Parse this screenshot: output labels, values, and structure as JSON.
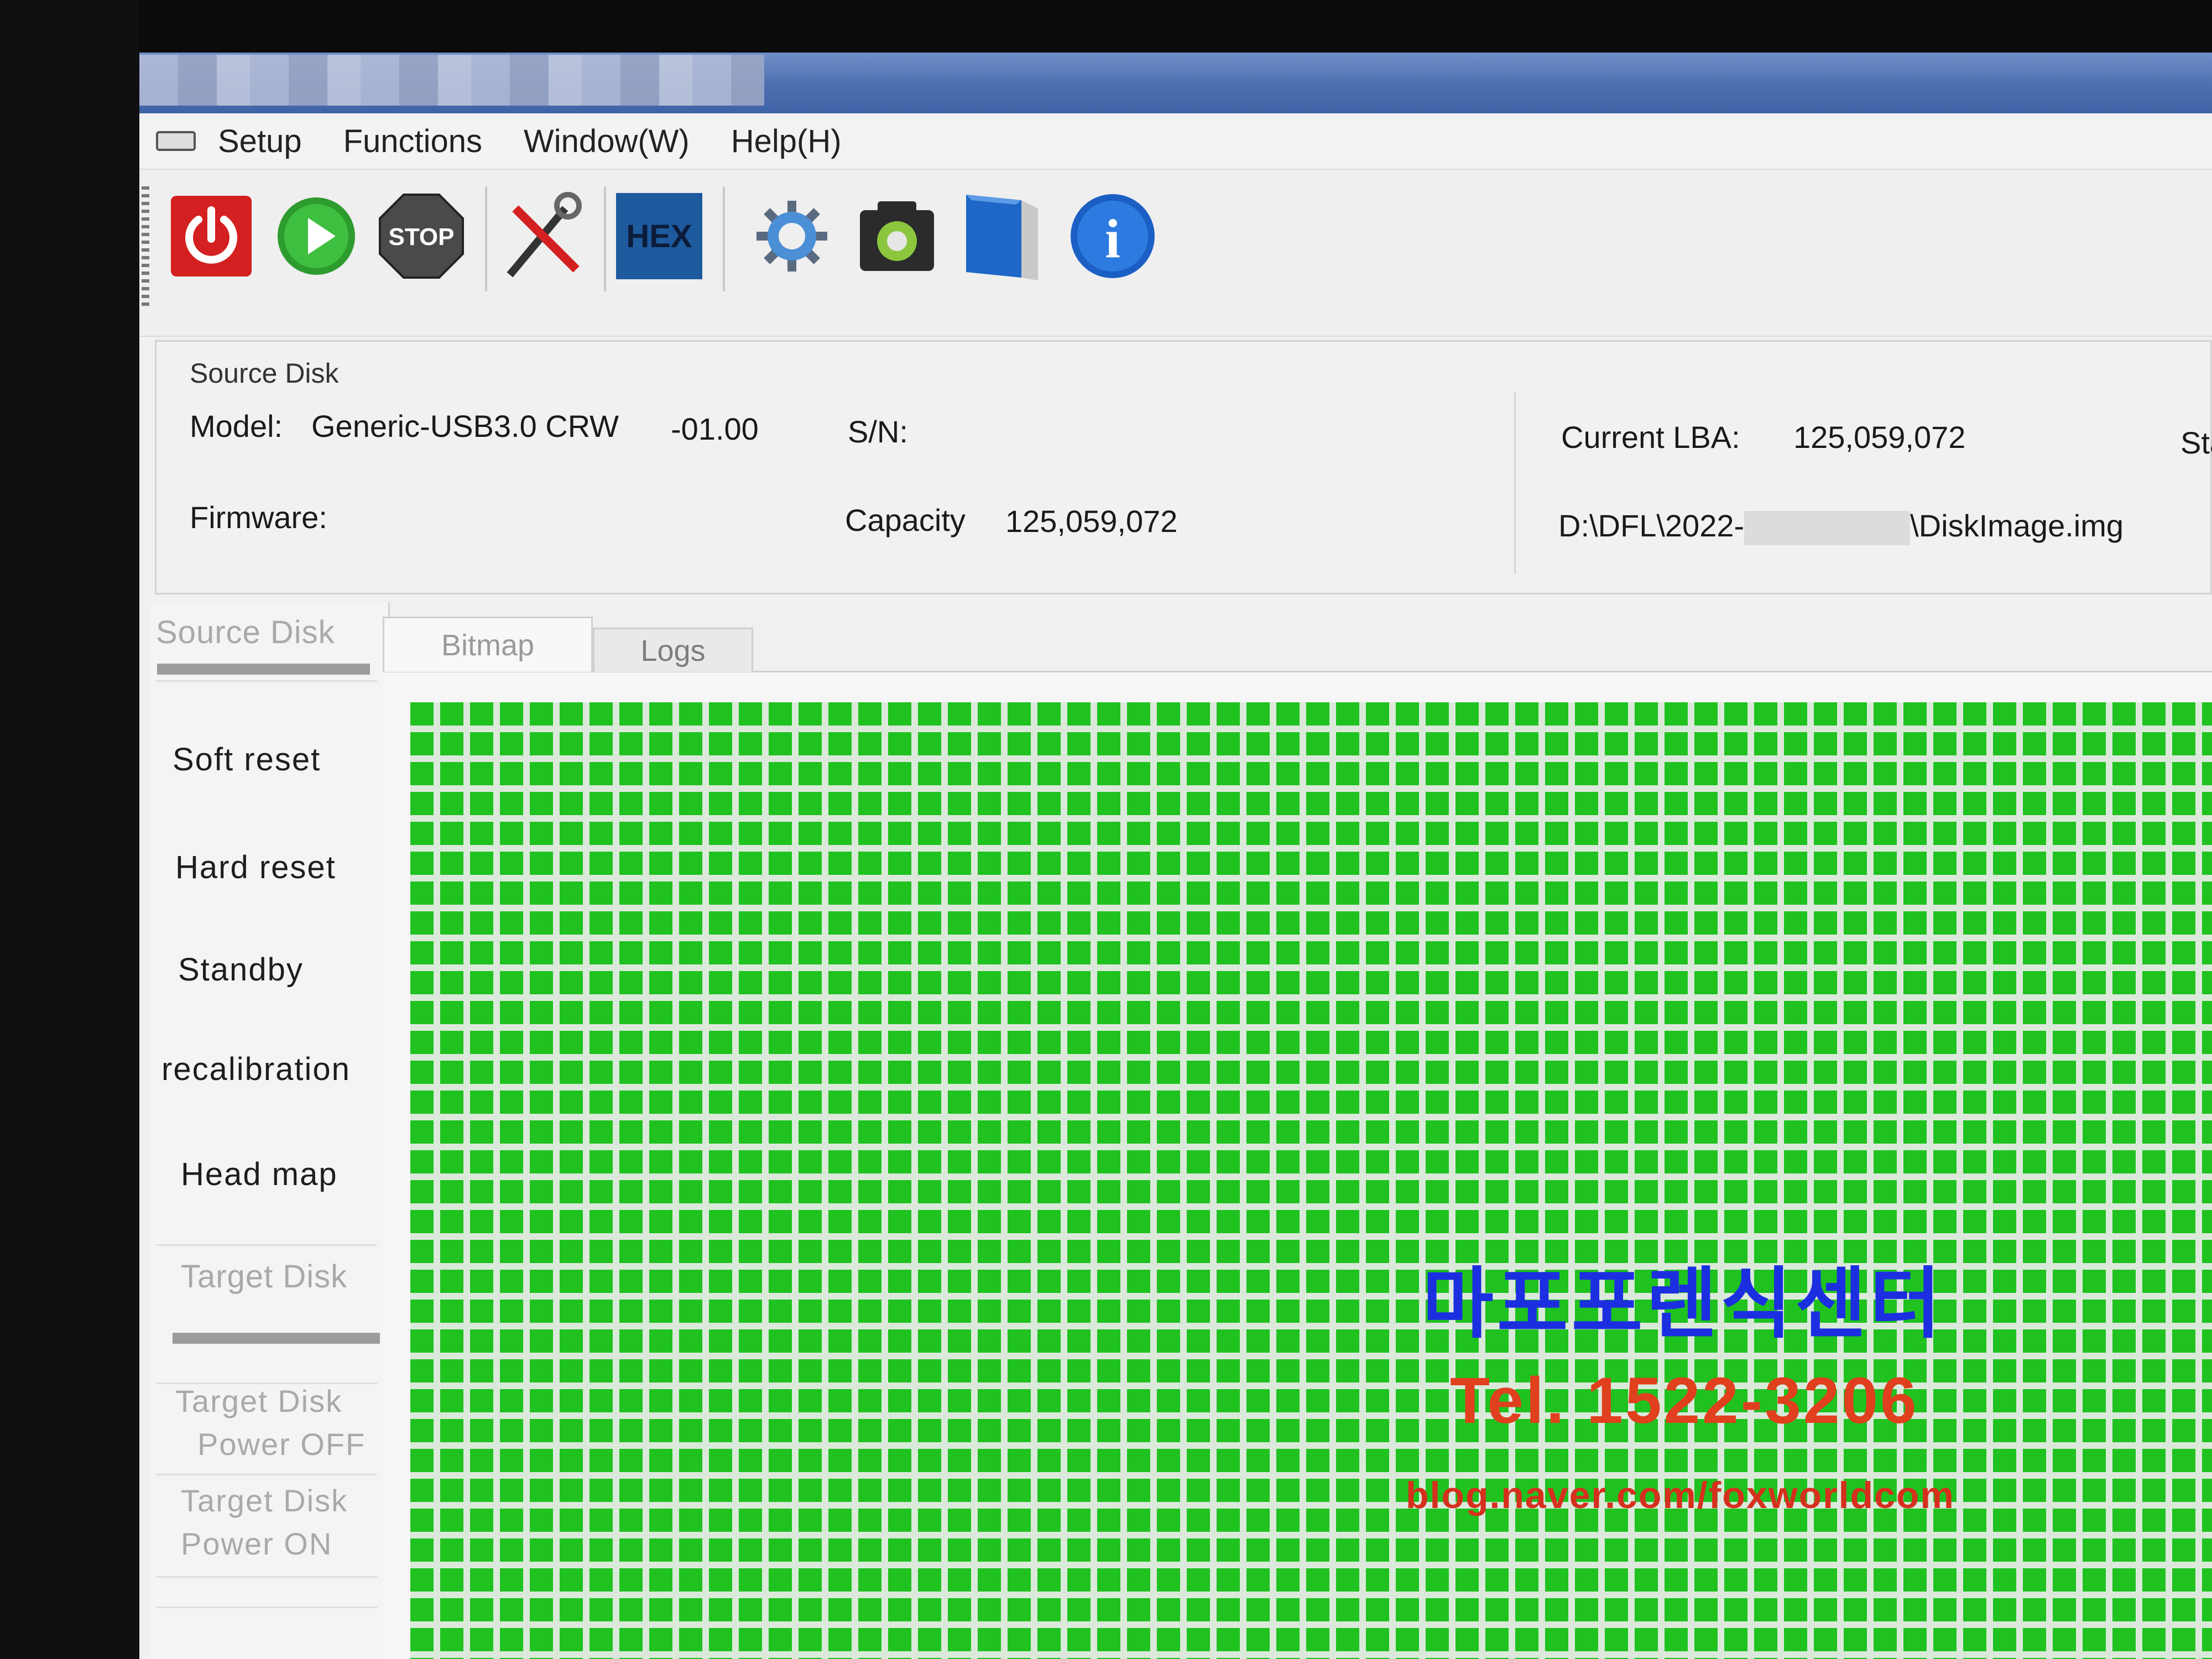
{
  "menu": {
    "items": [
      "Setup",
      "Functions",
      "Window(W)",
      "Help(H)"
    ]
  },
  "toolbar": {
    "buttons": [
      {
        "icon": "power-icon",
        "label": ""
      },
      {
        "icon": "play-icon",
        "label": ""
      },
      {
        "icon": "stop-icon",
        "label": "STOP"
      },
      {
        "icon": "tools-icon",
        "label": ""
      },
      {
        "icon": "hex-icon",
        "label": "HEX"
      },
      {
        "icon": "gear-icon",
        "label": ""
      },
      {
        "icon": "camera-icon",
        "label": ""
      },
      {
        "icon": "book-icon",
        "label": ""
      },
      {
        "icon": "info-icon",
        "label": "i"
      }
    ]
  },
  "source_disk": {
    "legend": "Source Disk",
    "model_label": "Model:",
    "model_value": "Generic-USB3.0 CRW",
    "model_rev": "-01.00",
    "sn_label": "S/N:",
    "firmware_label": "Firmware:",
    "capacity_label": "Capacity",
    "capacity_value": "125,059,072",
    "current_lba_label": "Current LBA:",
    "current_lba_value": "125,059,072",
    "path_prefix": "D:\\DFL\\2022-",
    "path_suffix": "\\DiskImage.img",
    "truncated_label": "Sta"
  },
  "sidebar": {
    "source_head": "Source Disk",
    "items": [
      "Soft reset",
      "Hard reset",
      "Standby",
      "recalibration",
      "Head map"
    ],
    "target_head": "Target Disk",
    "target_power_off": [
      "Target Disk",
      "Power OFF"
    ],
    "target_power_on": [
      "Target Disk",
      "Power ON"
    ]
  },
  "tabs": [
    "Bitmap",
    "Logs"
  ],
  "watermark": {
    "line1": "마포포렌식센터",
    "line2": "Tel. 1522-3206",
    "line3": "blog.naver.com/foxworldcom"
  },
  "colors": {
    "bitmap_green": "#1fc21f",
    "watermark_blue": "#1c2fe0",
    "watermark_red": "#e0401e"
  }
}
